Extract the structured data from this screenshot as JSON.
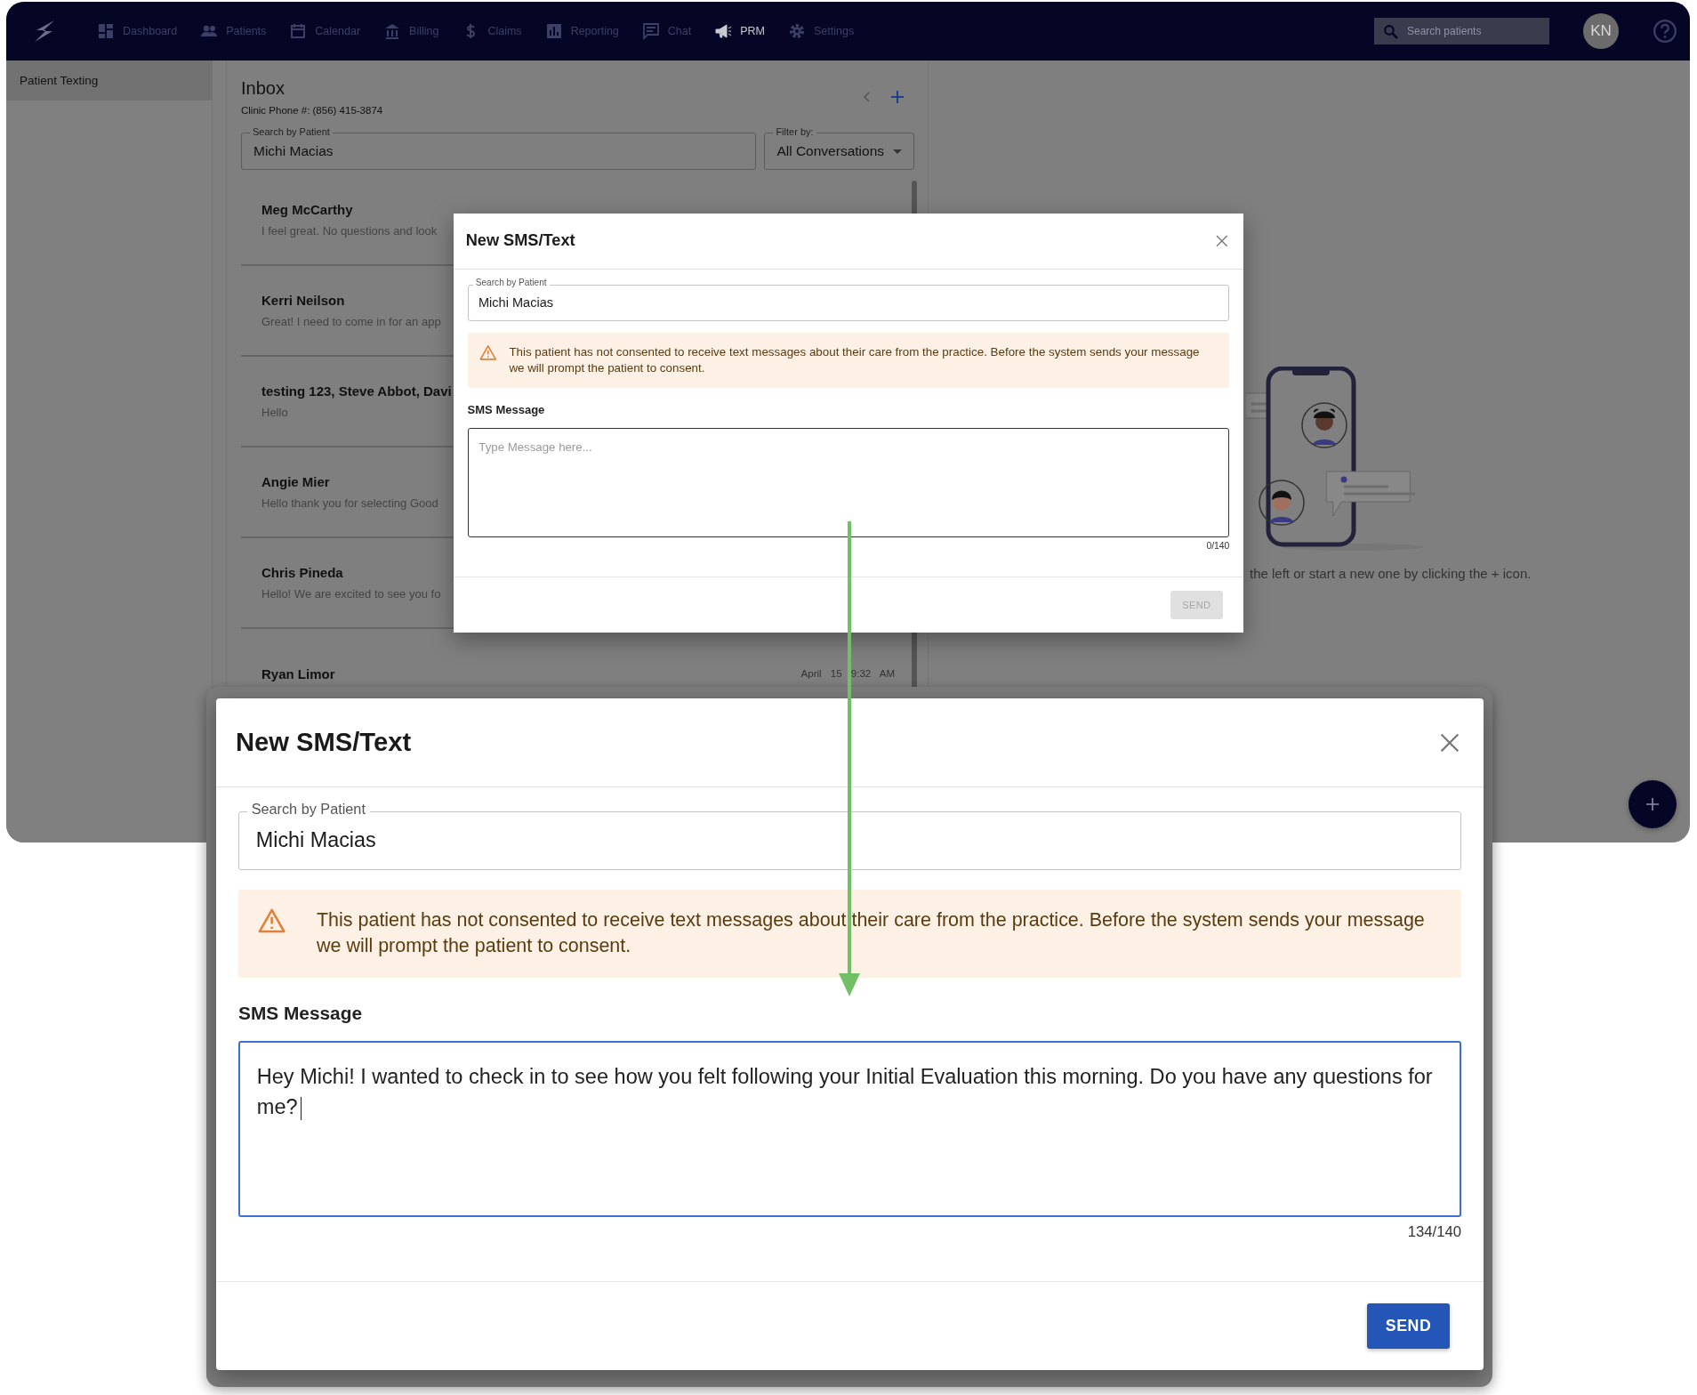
{
  "nav": {
    "items": [
      {
        "label": "Dashboard",
        "selected": false
      },
      {
        "label": "Patients",
        "selected": false
      },
      {
        "label": "Calendar",
        "selected": false
      },
      {
        "label": "Billing",
        "selected": false
      },
      {
        "label": "Claims",
        "selected": false
      },
      {
        "label": "Reporting",
        "selected": false
      },
      {
        "label": "Chat",
        "selected": false
      },
      {
        "label": "PRM",
        "selected": true
      },
      {
        "label": "Settings",
        "selected": false
      }
    ],
    "search": {
      "placeholder": "Search patients"
    },
    "avatar": "KN"
  },
  "sidebar": {
    "items": [
      {
        "label": "Patient Texting",
        "selected": true
      }
    ]
  },
  "inbox": {
    "title": "Inbox",
    "clinic_phone": "Clinic Phone #: (856) 415-3874",
    "search": {
      "label": "Search by Patient",
      "value": "Michi Macias"
    },
    "filter": {
      "label": "Filter by:",
      "value": "All Conversations"
    },
    "conversations": [
      {
        "name": "Meg McCarthy",
        "preview": "I feel great. No questions and look"
      },
      {
        "name": "Kerri Neilson",
        "preview": "Great! I need to come in for an app"
      },
      {
        "name": "testing 123, Steve Abbot, Davi",
        "preview": "Hello"
      },
      {
        "name": "Angie Mier",
        "preview": "Hello thank you for selecting Good"
      },
      {
        "name": "Chris Pineda",
        "preview": "Hello! We are excited to see you fo"
      },
      {
        "name": "Ryan Limor",
        "time": "April 15 9:32 AM"
      }
    ]
  },
  "empty_state": {
    "text": "the left or start a new one by clicking the + icon."
  },
  "dialog": {
    "title": "New SMS/Text",
    "search": {
      "label": "Search by Patient",
      "value": "Michi Macias"
    },
    "warning": "This patient has not consented to receive text messages about their care from the practice. Before the system sends your message we will prompt the patient to consent.",
    "message_label": "SMS Message",
    "message": {
      "placeholder": "Type Message here...",
      "focused": false
    },
    "counter": "0/140",
    "send": {
      "label": "SEND",
      "disabled": true
    }
  },
  "zoomed_dialog": {
    "title": "New SMS/Text",
    "search": {
      "label": "Search by Patient",
      "value": "Michi Macias"
    },
    "warning": "This patient has not consented to receive text messages about their care from the practice. Before the system sends your message we will prompt the patient to consent.",
    "message_label": "SMS Message",
    "message": {
      "value": "Hey Michi! I wanted to check in to see how you felt following your Initial Evaluation this morning. Do you have any questions for me?",
      "focused": true
    },
    "counter": "134/140",
    "send": {
      "label": "SEND",
      "disabled": false
    }
  }
}
